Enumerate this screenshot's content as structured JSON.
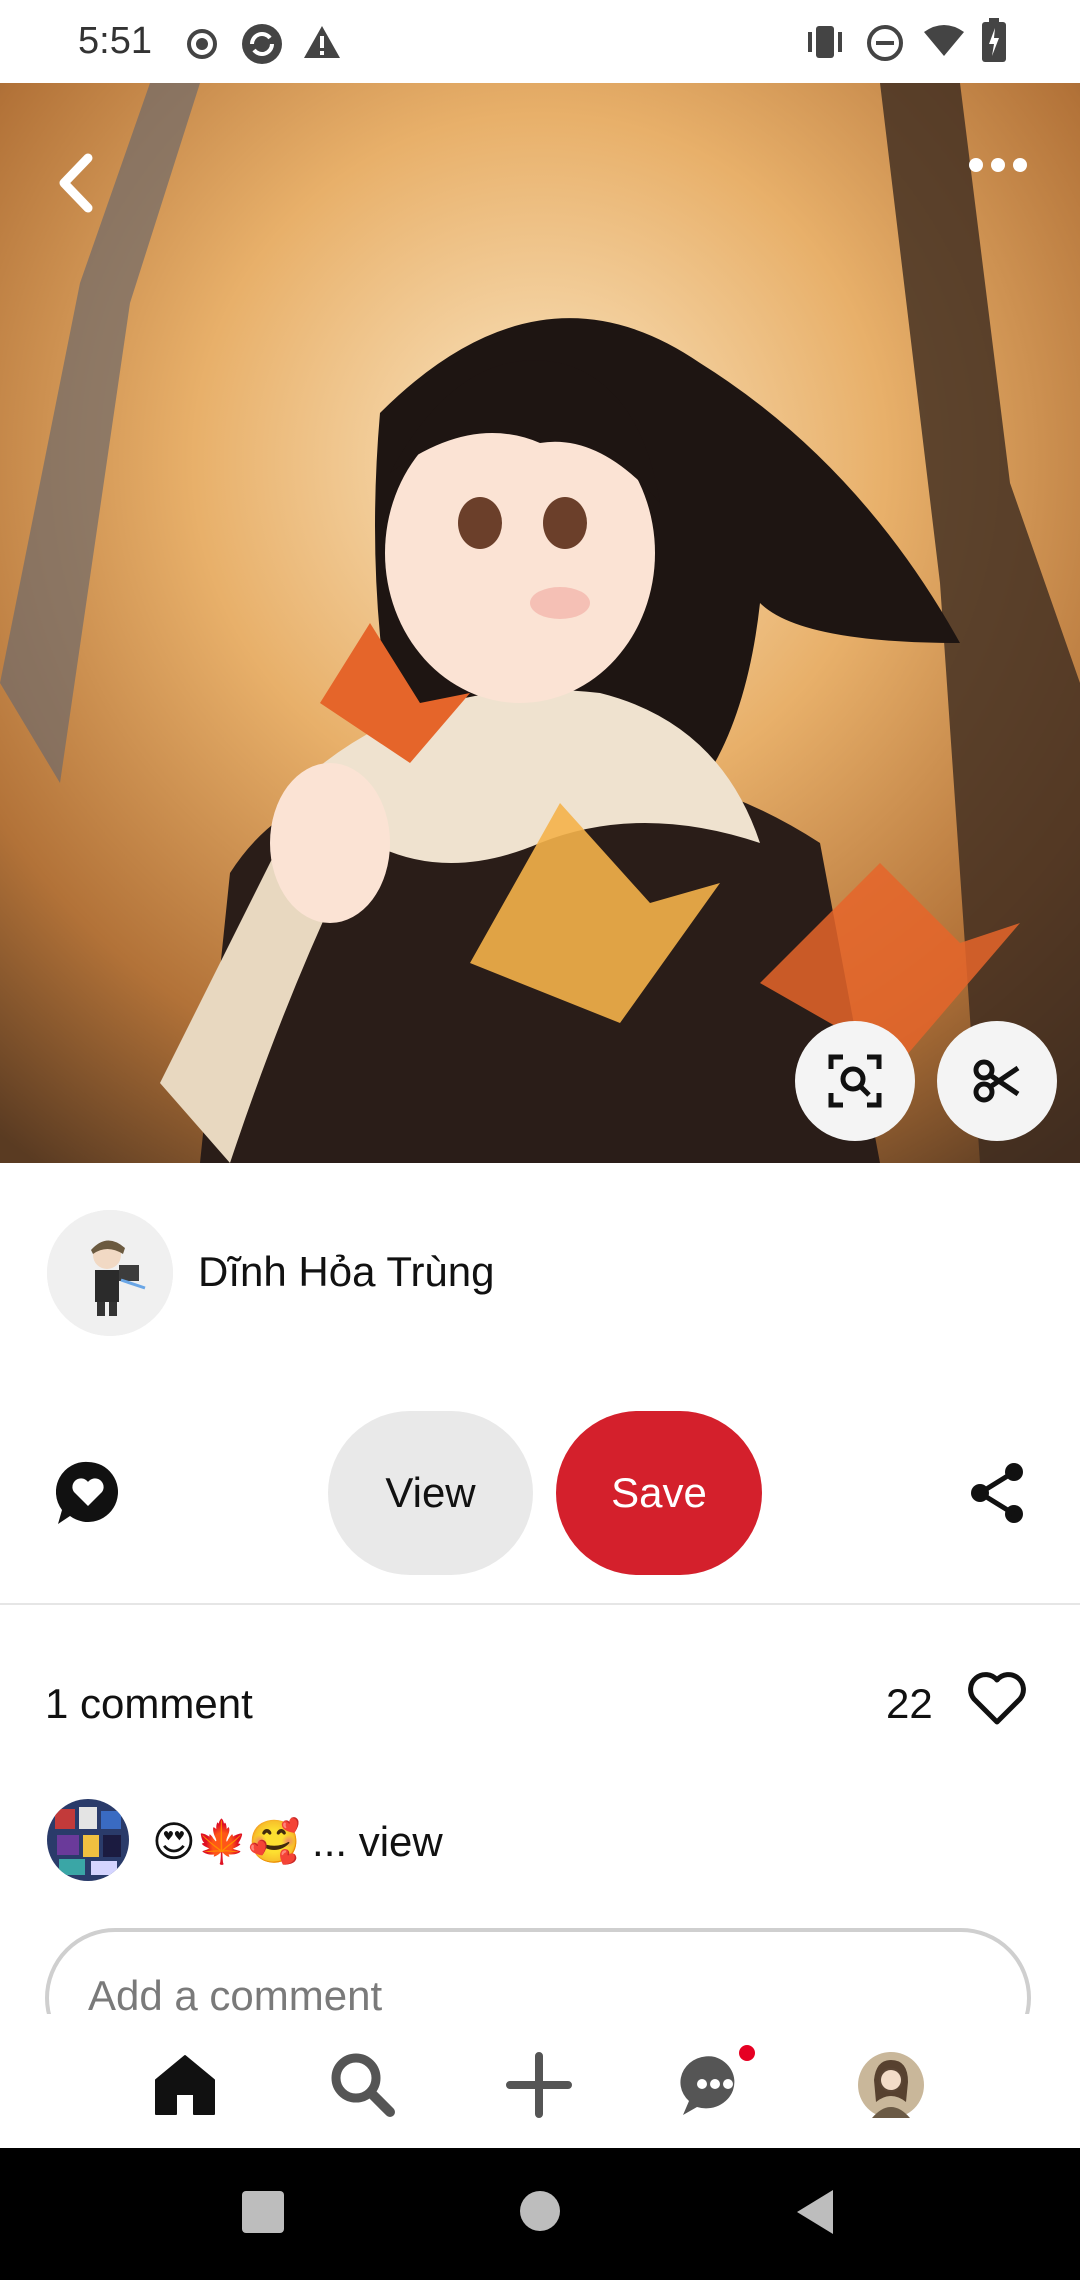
{
  "status_bar": {
    "time": "5:51",
    "icons": [
      "record-icon",
      "sync-icon",
      "alert-icon",
      "vibrate-icon",
      "dnd-icon",
      "wifi-icon",
      "battery-icon"
    ]
  },
  "header": {
    "back_icon": "chevron-left-icon",
    "more_icon": "more-horizontal-icon"
  },
  "hero": {
    "visual_search_icon": "visual-search-icon",
    "cutout_icon": "scissors-icon"
  },
  "author": {
    "name": "Dĩnh Hỏa Trùng"
  },
  "actions": {
    "react_icon": "heart-bubble-icon",
    "view_label": "View",
    "save_label": "Save",
    "share_icon": "share-icon"
  },
  "comments": {
    "count_label": "1 comment",
    "likes": "22",
    "preview_text": "😍🍁🥰 ... view",
    "input_placeholder": "Add a comment"
  },
  "bottom_nav": {
    "items": [
      "home-icon",
      "search-icon",
      "plus-icon",
      "messages-icon",
      "profile-icon"
    ]
  },
  "colors": {
    "save_red": "#d4202c",
    "view_gray": "#e9e9e9",
    "notification_dot": "#e60023"
  }
}
